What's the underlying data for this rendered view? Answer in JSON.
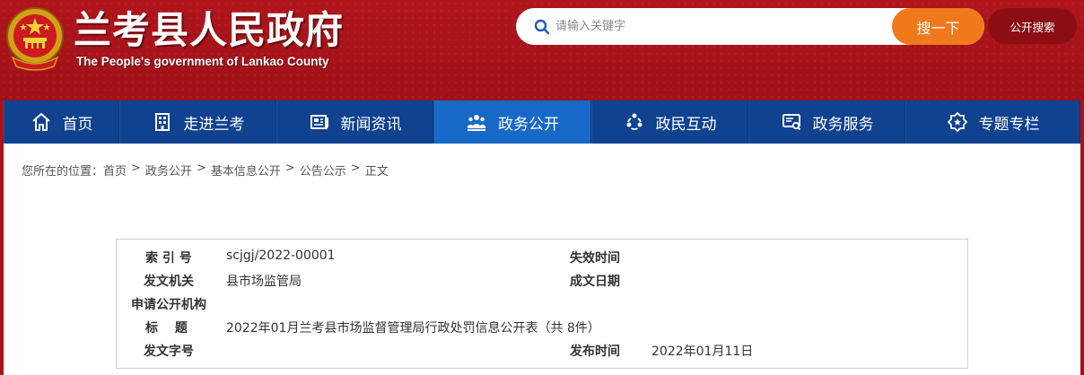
{
  "header": {
    "title": "兰考县人民政府",
    "subtitle": "The People's government of Lankao County",
    "search_placeholder": "请输入关键字",
    "search_button": "搜一下",
    "open_search_button": "公开搜索"
  },
  "nav": {
    "items": [
      {
        "label": "首页",
        "icon": "home-icon"
      },
      {
        "label": "走进兰考",
        "icon": "building-icon"
      },
      {
        "label": "新闻资讯",
        "icon": "newspaper-icon"
      },
      {
        "label": "政务公开",
        "icon": "people-icon",
        "active": true
      },
      {
        "label": "政民互动",
        "icon": "interaction-icon"
      },
      {
        "label": "政务服务",
        "icon": "service-icon"
      },
      {
        "label": "专题专栏",
        "icon": "badge-icon"
      }
    ]
  },
  "breadcrumb": {
    "prefix": "您所在的位置：",
    "items": [
      "首页",
      "政务公开",
      "基本信息公开",
      "公告公示",
      "正文"
    ],
    "separator": ">"
  },
  "info": {
    "index_label": "索 引 号",
    "index_value": "scjgj/2022-00001",
    "expire_label": "失效时间",
    "expire_value": "",
    "issuer_label": "发文机关",
    "issuer_value": "县市场监管局",
    "created_label": "成文日期",
    "created_value": "",
    "apply_label": "申请公开机构",
    "title_label": "标　 题",
    "title_value": "2022年01月兰考县市场监督管理局行政处罚信息公开表（共 8件）",
    "docno_label": "发文字号",
    "docno_value": "",
    "publish_label": "发布时间",
    "publish_value": "2022年01月11日"
  },
  "colors": {
    "header_red": "#b0141b",
    "nav_blue": "#11428f",
    "nav_active": "#1769c8",
    "search_orange": "#f07a1b"
  }
}
